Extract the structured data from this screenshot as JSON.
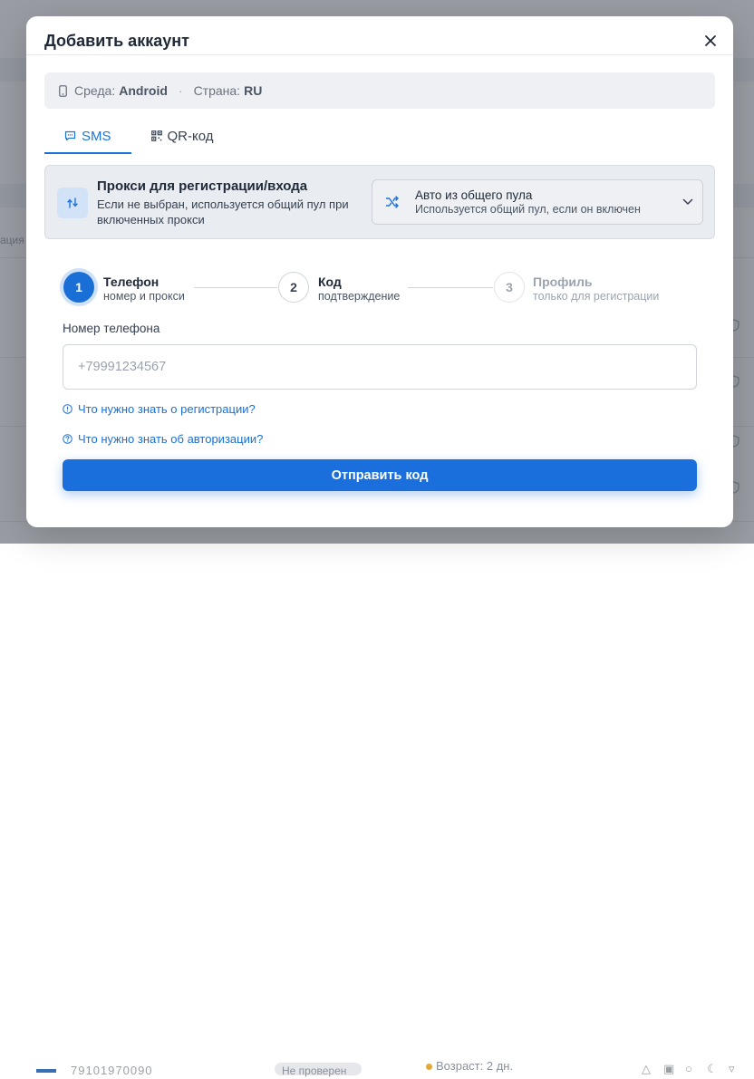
{
  "background": {
    "side_text": "ация",
    "bottom_row": {
      "phone_number": "79101970090",
      "status_pill": "Не проверен",
      "age_text": "Возраст: 2 дн."
    }
  },
  "modal": {
    "title": "Добавить аккаунт",
    "env": {
      "env_label": "Среда:",
      "env_value": "Android",
      "separator": "·",
      "country_label": "Страна:",
      "country_value": "RU"
    },
    "tabs": [
      {
        "label": "SMS",
        "active": true
      },
      {
        "label": "QR-код",
        "active": false
      }
    ],
    "proxy": {
      "title": "Прокси для регистрации/входа",
      "description": "Если не выбран, используется общий пул при включенных прокси",
      "select_main": "Авто из общего пула",
      "select_sub": "Используется общий пул, если он включен"
    },
    "steps": [
      {
        "number": "1",
        "title": "Телефон",
        "subtitle": "номер и прокси",
        "state": "active"
      },
      {
        "number": "2",
        "title": "Код",
        "subtitle": "подтверждение",
        "state": "pending"
      },
      {
        "number": "3",
        "title": "Профиль",
        "subtitle": "только для регистрации",
        "state": "muted"
      }
    ],
    "phone_field": {
      "label": "Номер телефона",
      "placeholder": "+79991234567",
      "value": ""
    },
    "help_links": [
      {
        "label": "Что нужно знать о регистрации?",
        "icon": "info-circle-icon"
      },
      {
        "label": "Что нужно знать об авторизации?",
        "icon": "question-circle-icon"
      }
    ],
    "submit_label": "Отправить код"
  },
  "colors": {
    "accent": "#1a6fdc",
    "overlay": "rgba(40,46,58,0.45)"
  }
}
